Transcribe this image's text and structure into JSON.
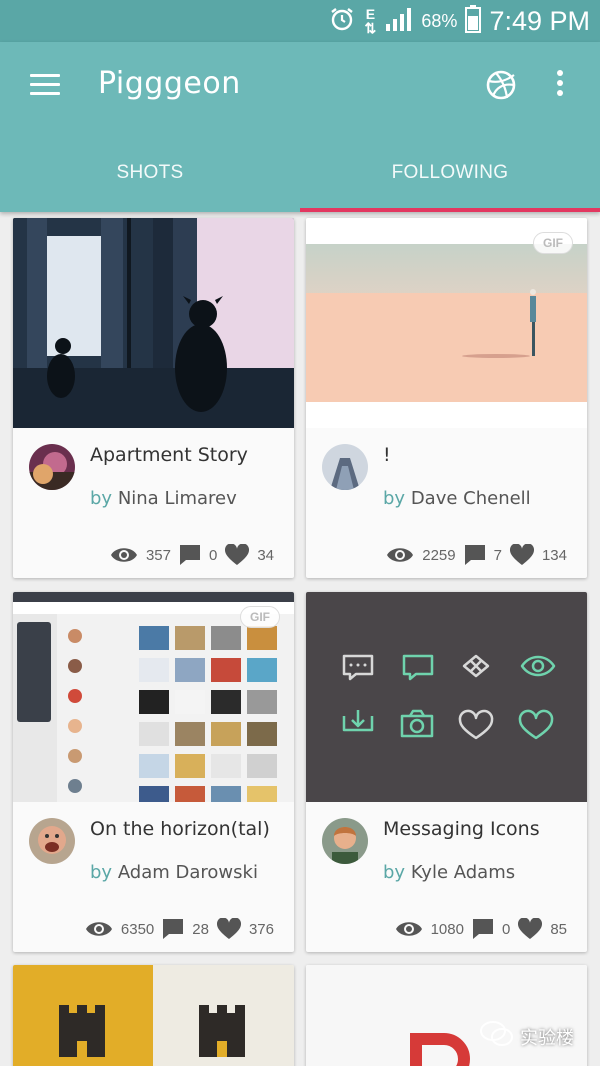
{
  "status_bar": {
    "time": "7:49 PM",
    "battery": "68%",
    "network": "E"
  },
  "app_bar": {
    "title": "Pigggeon"
  },
  "tabs": [
    {
      "label": "SHOTS"
    },
    {
      "label": "FOLLOWING"
    }
  ],
  "gif_label": "GIF",
  "shots": [
    {
      "title": "Apartment Story",
      "by": "by",
      "author": "Nina Limarev",
      "views": "357",
      "comments": "0",
      "likes": "34",
      "gif": false
    },
    {
      "title": "!",
      "by": "by",
      "author": "Dave Chenell",
      "views": "2259",
      "comments": "7",
      "likes": "134",
      "gif": true
    },
    {
      "title": "On the horizon(tal)",
      "by": "by",
      "author": "Adam Darowski",
      "views": "6350",
      "comments": "28",
      "likes": "376",
      "gif": true
    },
    {
      "title": "Messaging Icons",
      "by": "by",
      "author": "Kyle Adams",
      "views": "1080",
      "comments": "0",
      "likes": "85",
      "gif": false
    }
  ],
  "watermark": {
    "text": "实验楼"
  },
  "colors": {
    "status_bar": "#5aa7a6",
    "app_bar": "#6db9b8",
    "tab_indicator": "#e23760",
    "accent": "#5aa7a6"
  }
}
